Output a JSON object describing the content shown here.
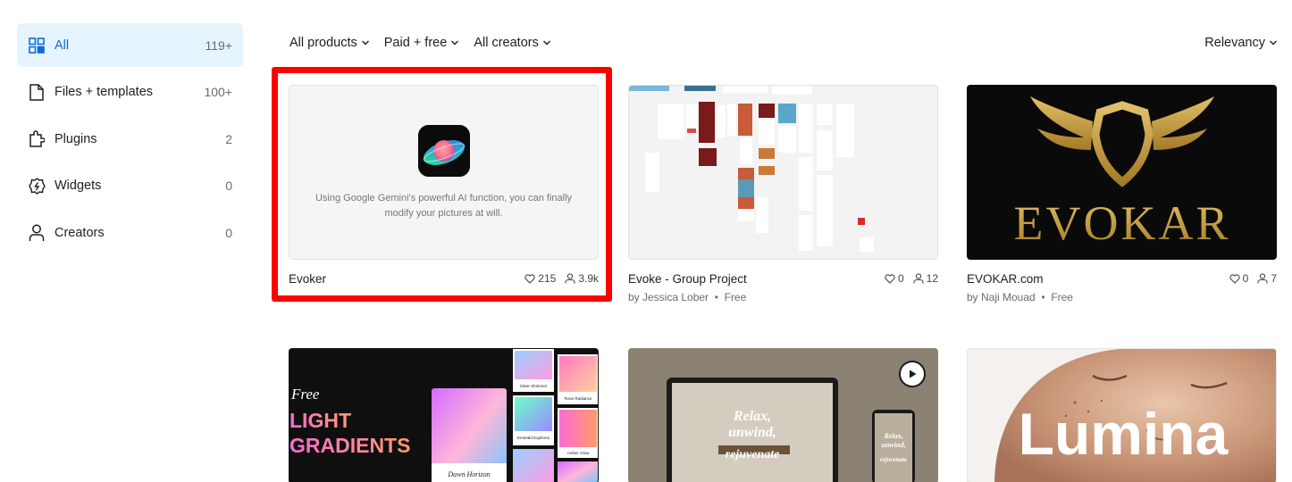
{
  "sidebar": {
    "items": [
      {
        "label": "All",
        "count": "119+",
        "icon": "grid-icon",
        "active": true
      },
      {
        "label": "Files + templates",
        "count": "100+",
        "icon": "file-icon"
      },
      {
        "label": "Plugins",
        "count": "2",
        "icon": "plugin-icon"
      },
      {
        "label": "Widgets",
        "count": "0",
        "icon": "widget-icon"
      },
      {
        "label": "Creators",
        "count": "0",
        "icon": "person-icon"
      }
    ]
  },
  "filters": {
    "products": "All products",
    "price": "Paid + free",
    "creators": "All creators",
    "sort": "Relevancy"
  },
  "cards": [
    {
      "title": "Evoker",
      "description": "Using Google Gemini's powerful AI function, you can finally modify your pictures at will.",
      "likes": "215",
      "users": "3.9k"
    },
    {
      "title": "Evoke - Group Project",
      "author": "by Jessica Lober",
      "price": "Free",
      "likes": "0",
      "users": "12"
    },
    {
      "title": "EVOKAR.com",
      "author": "by Naji Mouad",
      "price": "Free",
      "likes": "0",
      "users": "7",
      "logo_text": "EVOKAR"
    },
    {
      "thumb_lines": [
        "Free",
        "LIGHT",
        "GRADIENTS"
      ],
      "swatches": [
        "Silver Shimmer",
        "Rose Radiance",
        "Emerald Euphoria",
        "Amber Glow",
        "Dawn Horizon"
      ]
    },
    {
      "thumb_lines": [
        "Relax,",
        "unwind,",
        "rejuvenate"
      ]
    },
    {
      "logo_text": "Lumina"
    }
  ],
  "colors": {
    "accent": "#0d6bd6",
    "active_bg": "#e5f4ff",
    "highlight": "#ff0000",
    "gold": "#c9a13a"
  }
}
